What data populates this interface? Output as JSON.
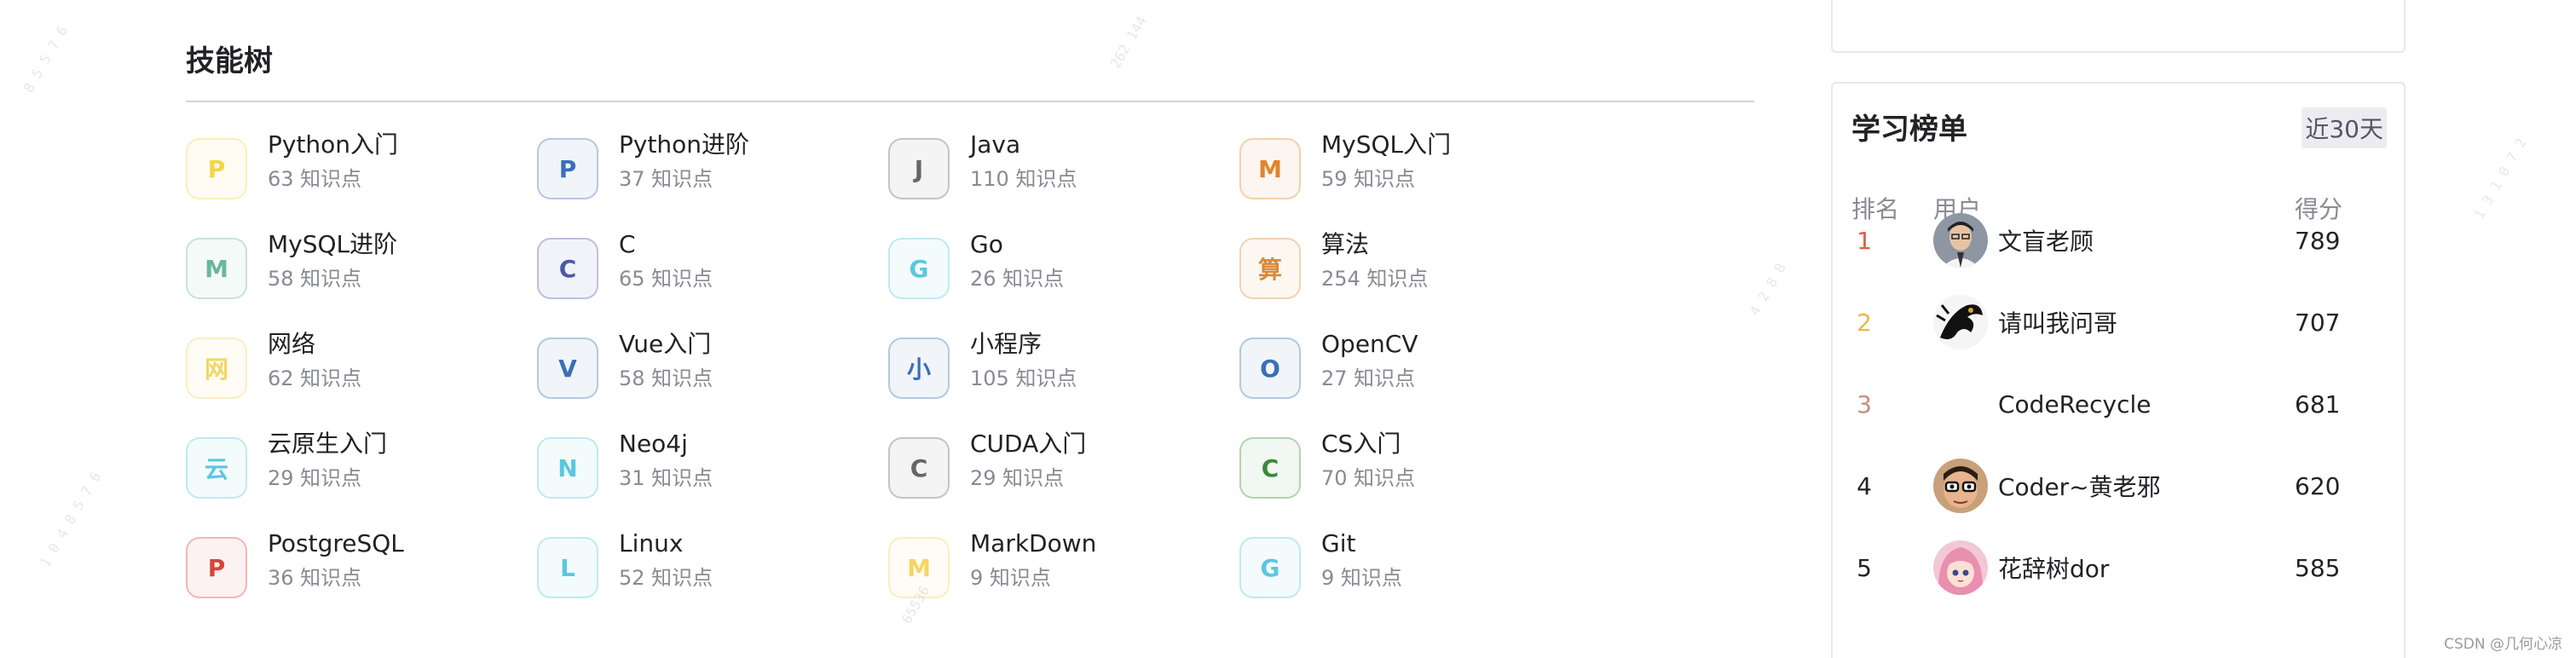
{
  "skill_tree": {
    "title": "技能树",
    "items": [
      {
        "letter": "P",
        "name": "Python入门",
        "count": "63 知识点",
        "color": "#f5d547"
      },
      {
        "letter": "P",
        "name": "Python进阶",
        "count": "37 知识点",
        "color": "#3a6fb7"
      },
      {
        "letter": "J",
        "name": "Java",
        "count": "110 知识点",
        "color": "#666666"
      },
      {
        "letter": "M",
        "name": "MySQL入门",
        "count": "59 知识点",
        "color": "#e0852b"
      },
      {
        "letter": "M",
        "name": "MySQL进阶",
        "count": "58 知识点",
        "color": "#6ab6a0"
      },
      {
        "letter": "C",
        "name": "C",
        "count": "65 知识点",
        "color": "#4a5aa8"
      },
      {
        "letter": "G",
        "name": "Go",
        "count": "26 知识点",
        "color": "#5bc7e0"
      },
      {
        "letter": "算",
        "name": "算法",
        "count": "254 知识点",
        "color": "#d98a3a"
      },
      {
        "letter": "网",
        "name": "网络",
        "count": "62 知识点",
        "color": "#f3d663"
      },
      {
        "letter": "V",
        "name": "Vue入门",
        "count": "58 知识点",
        "color": "#3a6fb7"
      },
      {
        "letter": "小",
        "name": "小程序",
        "count": "105 知识点",
        "color": "#3a6fb7"
      },
      {
        "letter": "O",
        "name": "OpenCV",
        "count": "27 知识点",
        "color": "#3a6fb7"
      },
      {
        "letter": "云",
        "name": "云原生入门",
        "count": "29 知识点",
        "color": "#5bc7e0"
      },
      {
        "letter": "N",
        "name": "Neo4j",
        "count": "31 知识点",
        "color": "#5bc7e0"
      },
      {
        "letter": "C",
        "name": "CUDA入门",
        "count": "29 知识点",
        "color": "#666666"
      },
      {
        "letter": "C",
        "name": "CS入门",
        "count": "70 知识点",
        "color": "#3a8a3a"
      },
      {
        "letter": "P",
        "name": "PostgreSQL",
        "count": "36 知识点",
        "color": "#d9443a"
      },
      {
        "letter": "L",
        "name": "Linux",
        "count": "52 知识点",
        "color": "#5bc7e0"
      },
      {
        "letter": "M",
        "name": "MarkDown",
        "count": "9 知识点",
        "color": "#f3d663"
      },
      {
        "letter": "G",
        "name": "Git",
        "count": "9 知识点",
        "color": "#5bc7e0"
      }
    ]
  },
  "ranking": {
    "title": "学习榜单",
    "filter": "近30天",
    "headers": {
      "rank": "排名",
      "user": "用户",
      "score": "得分"
    },
    "rows": [
      {
        "rank": "1",
        "user": "文盲老顾",
        "score": "789",
        "rank_color": "#e25b45",
        "avatar": "avatar-man-glasses"
      },
      {
        "rank": "2",
        "user": "请叫我问哥",
        "score": "707",
        "rank_color": "#e8b84a",
        "avatar": "avatar-dragon"
      },
      {
        "rank": "3",
        "user": "CodeRecycle",
        "score": "681",
        "rank_color": "#c58e7a",
        "avatar": ""
      },
      {
        "rank": "4",
        "user": "Coder~黄老邪",
        "score": "620",
        "rank_color": "#222226",
        "avatar": "avatar-cartoon-glasses"
      },
      {
        "rank": "5",
        "user": "花辞树dor",
        "score": "585",
        "rank_color": "#222226",
        "avatar": "avatar-pink-anime"
      }
    ]
  },
  "watermark": "CSDN @几何心凉"
}
